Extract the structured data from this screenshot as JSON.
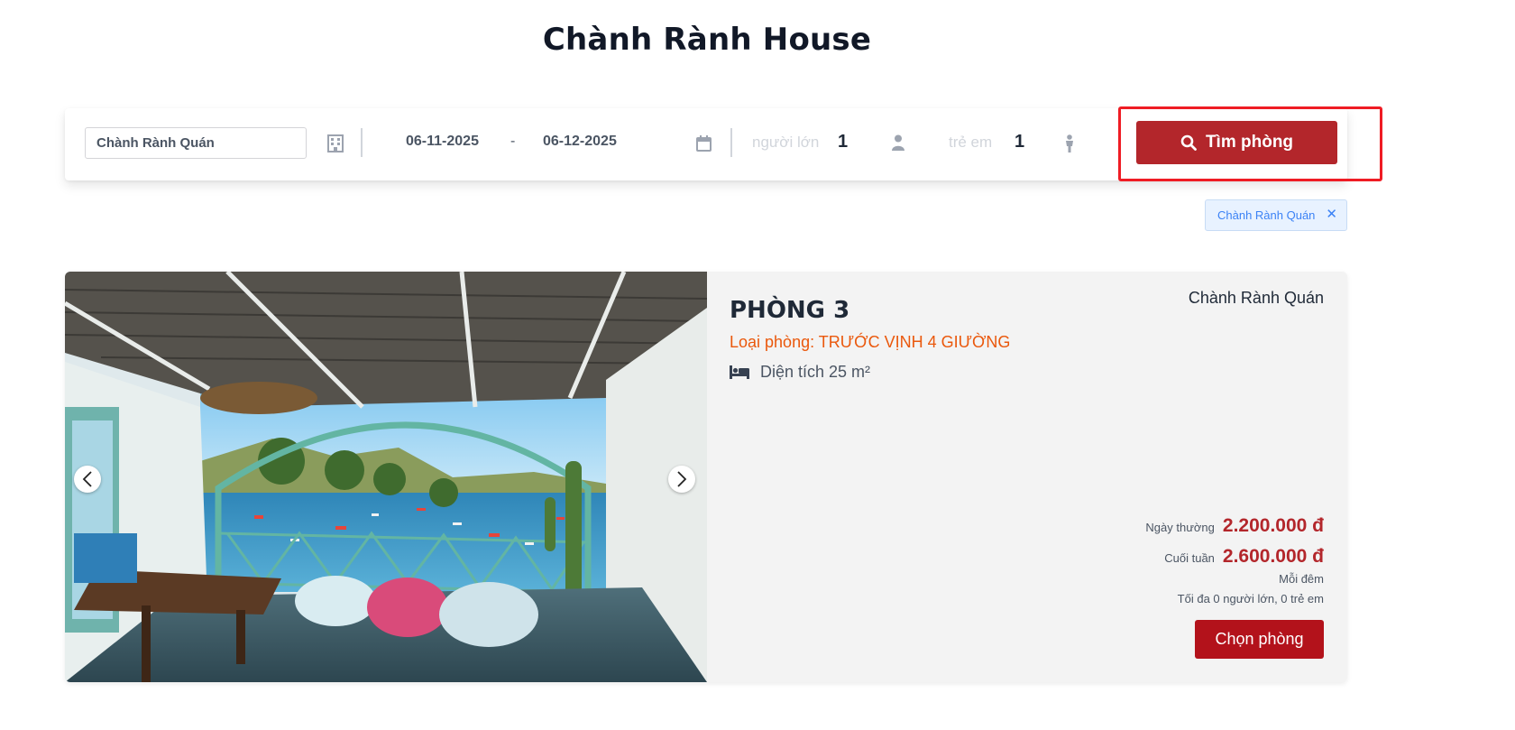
{
  "page": {
    "title": "Chành Rành House"
  },
  "search": {
    "hotel_value": "Chành Rành Quán",
    "checkin": "06-11-2025",
    "date_separator": "-",
    "checkout": "06-12-2025",
    "adults_label": "người lớn",
    "adults_count": "1",
    "children_label": "trẻ em",
    "children_count": "1",
    "button_label": "Tìm phòng",
    "icons": [
      "building-icon",
      "calendar-icon",
      "adult-person-icon",
      "child-person-icon",
      "search-icon"
    ]
  },
  "filters": {
    "active_tag": "Chành Rành Quán",
    "close_glyph": "✕"
  },
  "room": {
    "name": "PHÒNG 3",
    "type": "Loại phòng: TRƯỚC VỊNH 4 GIƯỜNG",
    "area": "Diện tích 25 m²",
    "hotel": "Chành Rành Quán",
    "weekday_label": "Ngày thường",
    "weekday_price": "2.200.000 đ",
    "weekend_label": "Cuối tuần",
    "weekend_price": "2.600.000 đ",
    "per_night": "Mỗi đêm",
    "max_guests": "Tối đa 0 người lớn, 0 trẻ em",
    "choose_label": "Chọn phòng"
  },
  "colors": {
    "primary_red": "#b3262b",
    "highlight_red": "#ef1c24",
    "orange_text": "#ea580c",
    "tag_blue": "#3b82f6"
  }
}
